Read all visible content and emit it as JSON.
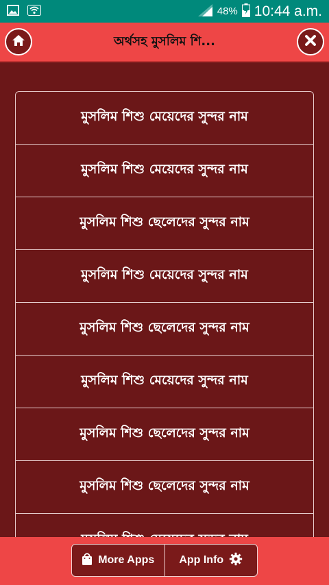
{
  "status_bar": {
    "battery": "48%",
    "time": "10:44 a.m."
  },
  "header": {
    "title": "অর্থসহ মুসলিম শি..."
  },
  "list": {
    "items": [
      "মুসলিম শিশু মেয়েদের সুন্দর নাম",
      "মুসলিম শিশু মেয়েদের সুন্দর নাম",
      "মুসলিম শিশু ছেলেদের সুন্দর নাম",
      "মুসলিম শিশু মেয়েদের সুন্দর নাম",
      "মুসলিম শিশু ছেলেদের সুন্দর নাম",
      "মুসলিম শিশু মেয়েদের সুন্দর নাম",
      "মুসলিম শিশু ছেলেদের সুন্দর নাম",
      "মুসলিম শিশু ছেলেদের সুন্দর নাম",
      "মুসলিম শিশু মেয়েদের সুন্দর নাম"
    ]
  },
  "bottom_bar": {
    "more_apps_label": "More Apps",
    "app_info_label": "App Info"
  },
  "colors": {
    "status_bar": "#00897b",
    "header": "#ee4646",
    "background": "#6b1718"
  }
}
